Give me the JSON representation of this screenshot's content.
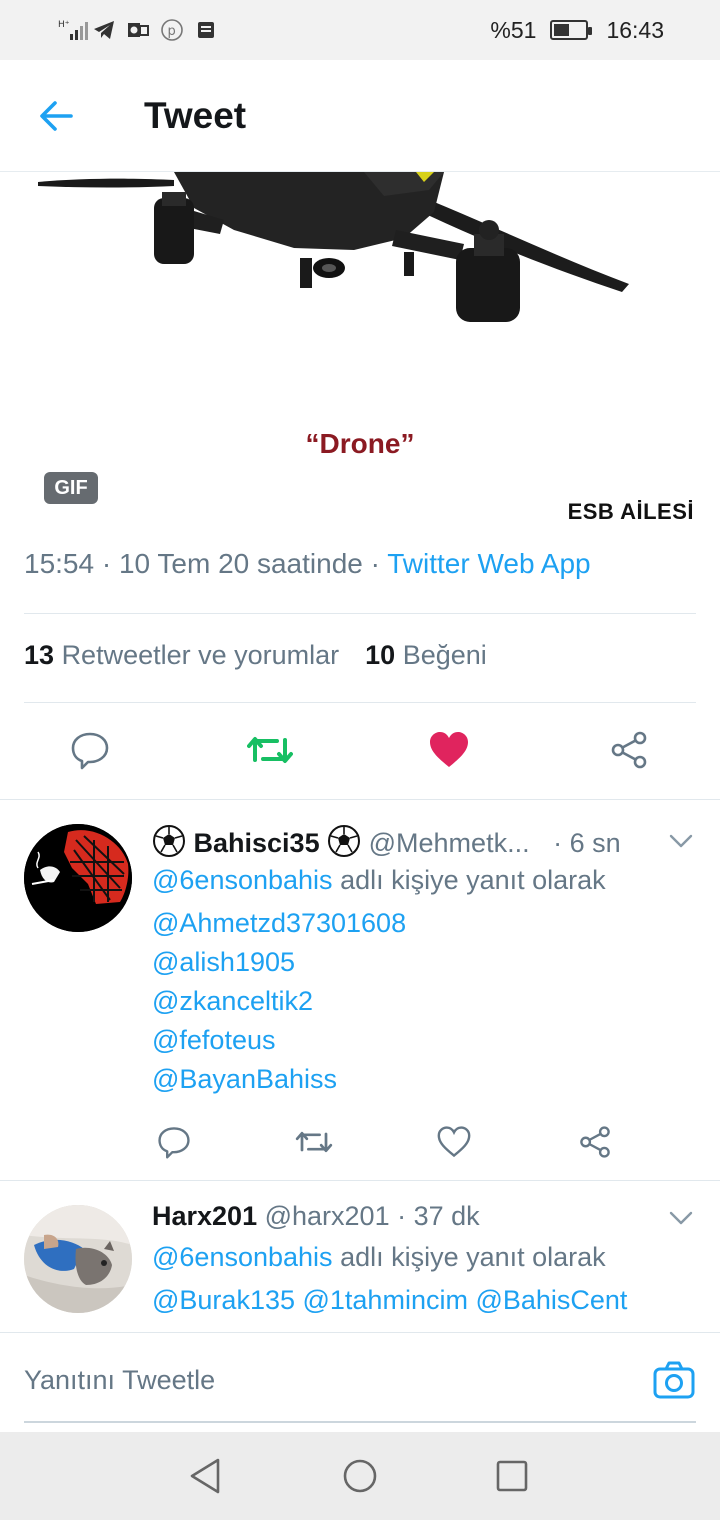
{
  "status_bar": {
    "battery_text": "%51",
    "battery_level": 0.51,
    "time": "16:43",
    "icons": [
      "network-signal-icon",
      "telegram-icon",
      "outlook-icon",
      "pinterest-icon",
      "notes-icon"
    ]
  },
  "header": {
    "back_icon": "arrow-left-icon",
    "title": "Tweet"
  },
  "media": {
    "caption": "“Drone”",
    "badge": "GIF",
    "watermark": "ESB AİLESİ"
  },
  "tweet_meta": {
    "time": "15:54",
    "date": "10 Tem 20 saatinde",
    "sep": "·",
    "source": "Twitter Web App"
  },
  "stats": {
    "retweets_count": "13",
    "retweets_label": "Retweetler ve yorumlar",
    "likes_count": "10",
    "likes_label": "Beğeni"
  },
  "actions": {
    "reply_icon": "reply-icon",
    "retweet_icon": "retweet-icon",
    "like_icon": "heart-icon",
    "share_icon": "share-icon",
    "retweet_color": "#17bf63",
    "like_color": "#e0245e"
  },
  "replies": [
    {
      "display_name": "Bahisci35",
      "handle": "@Mehmetk...",
      "time": "· 6 sn",
      "reply_to_handle": "@6ensonbahis",
      "reply_to_text": "adlı kişiye yanıt olarak",
      "mentions": [
        "@Ahmetzd37301608",
        "@alish1905",
        "@zkanceltik2",
        "@fefoteus",
        "@BayanBahiss"
      ]
    },
    {
      "display_name": "Harx201",
      "handle": "@harx201",
      "time": "· 37 dk",
      "reply_to_handle": "@6ensonbahis",
      "reply_to_text": "adlı kişiye yanıt olarak",
      "mentions_line": "@Burak135 @1tahmincim @BahisCent"
    }
  ],
  "compose": {
    "placeholder": "Yanıtını Tweetle",
    "camera_icon": "camera-icon"
  },
  "nav_bar": {
    "icons": [
      "back-triangle-icon",
      "home-circle-icon",
      "recents-square-icon"
    ]
  },
  "colors": {
    "accent": "#1da1f2",
    "text_primary": "#14171a",
    "text_secondary": "#657786"
  }
}
